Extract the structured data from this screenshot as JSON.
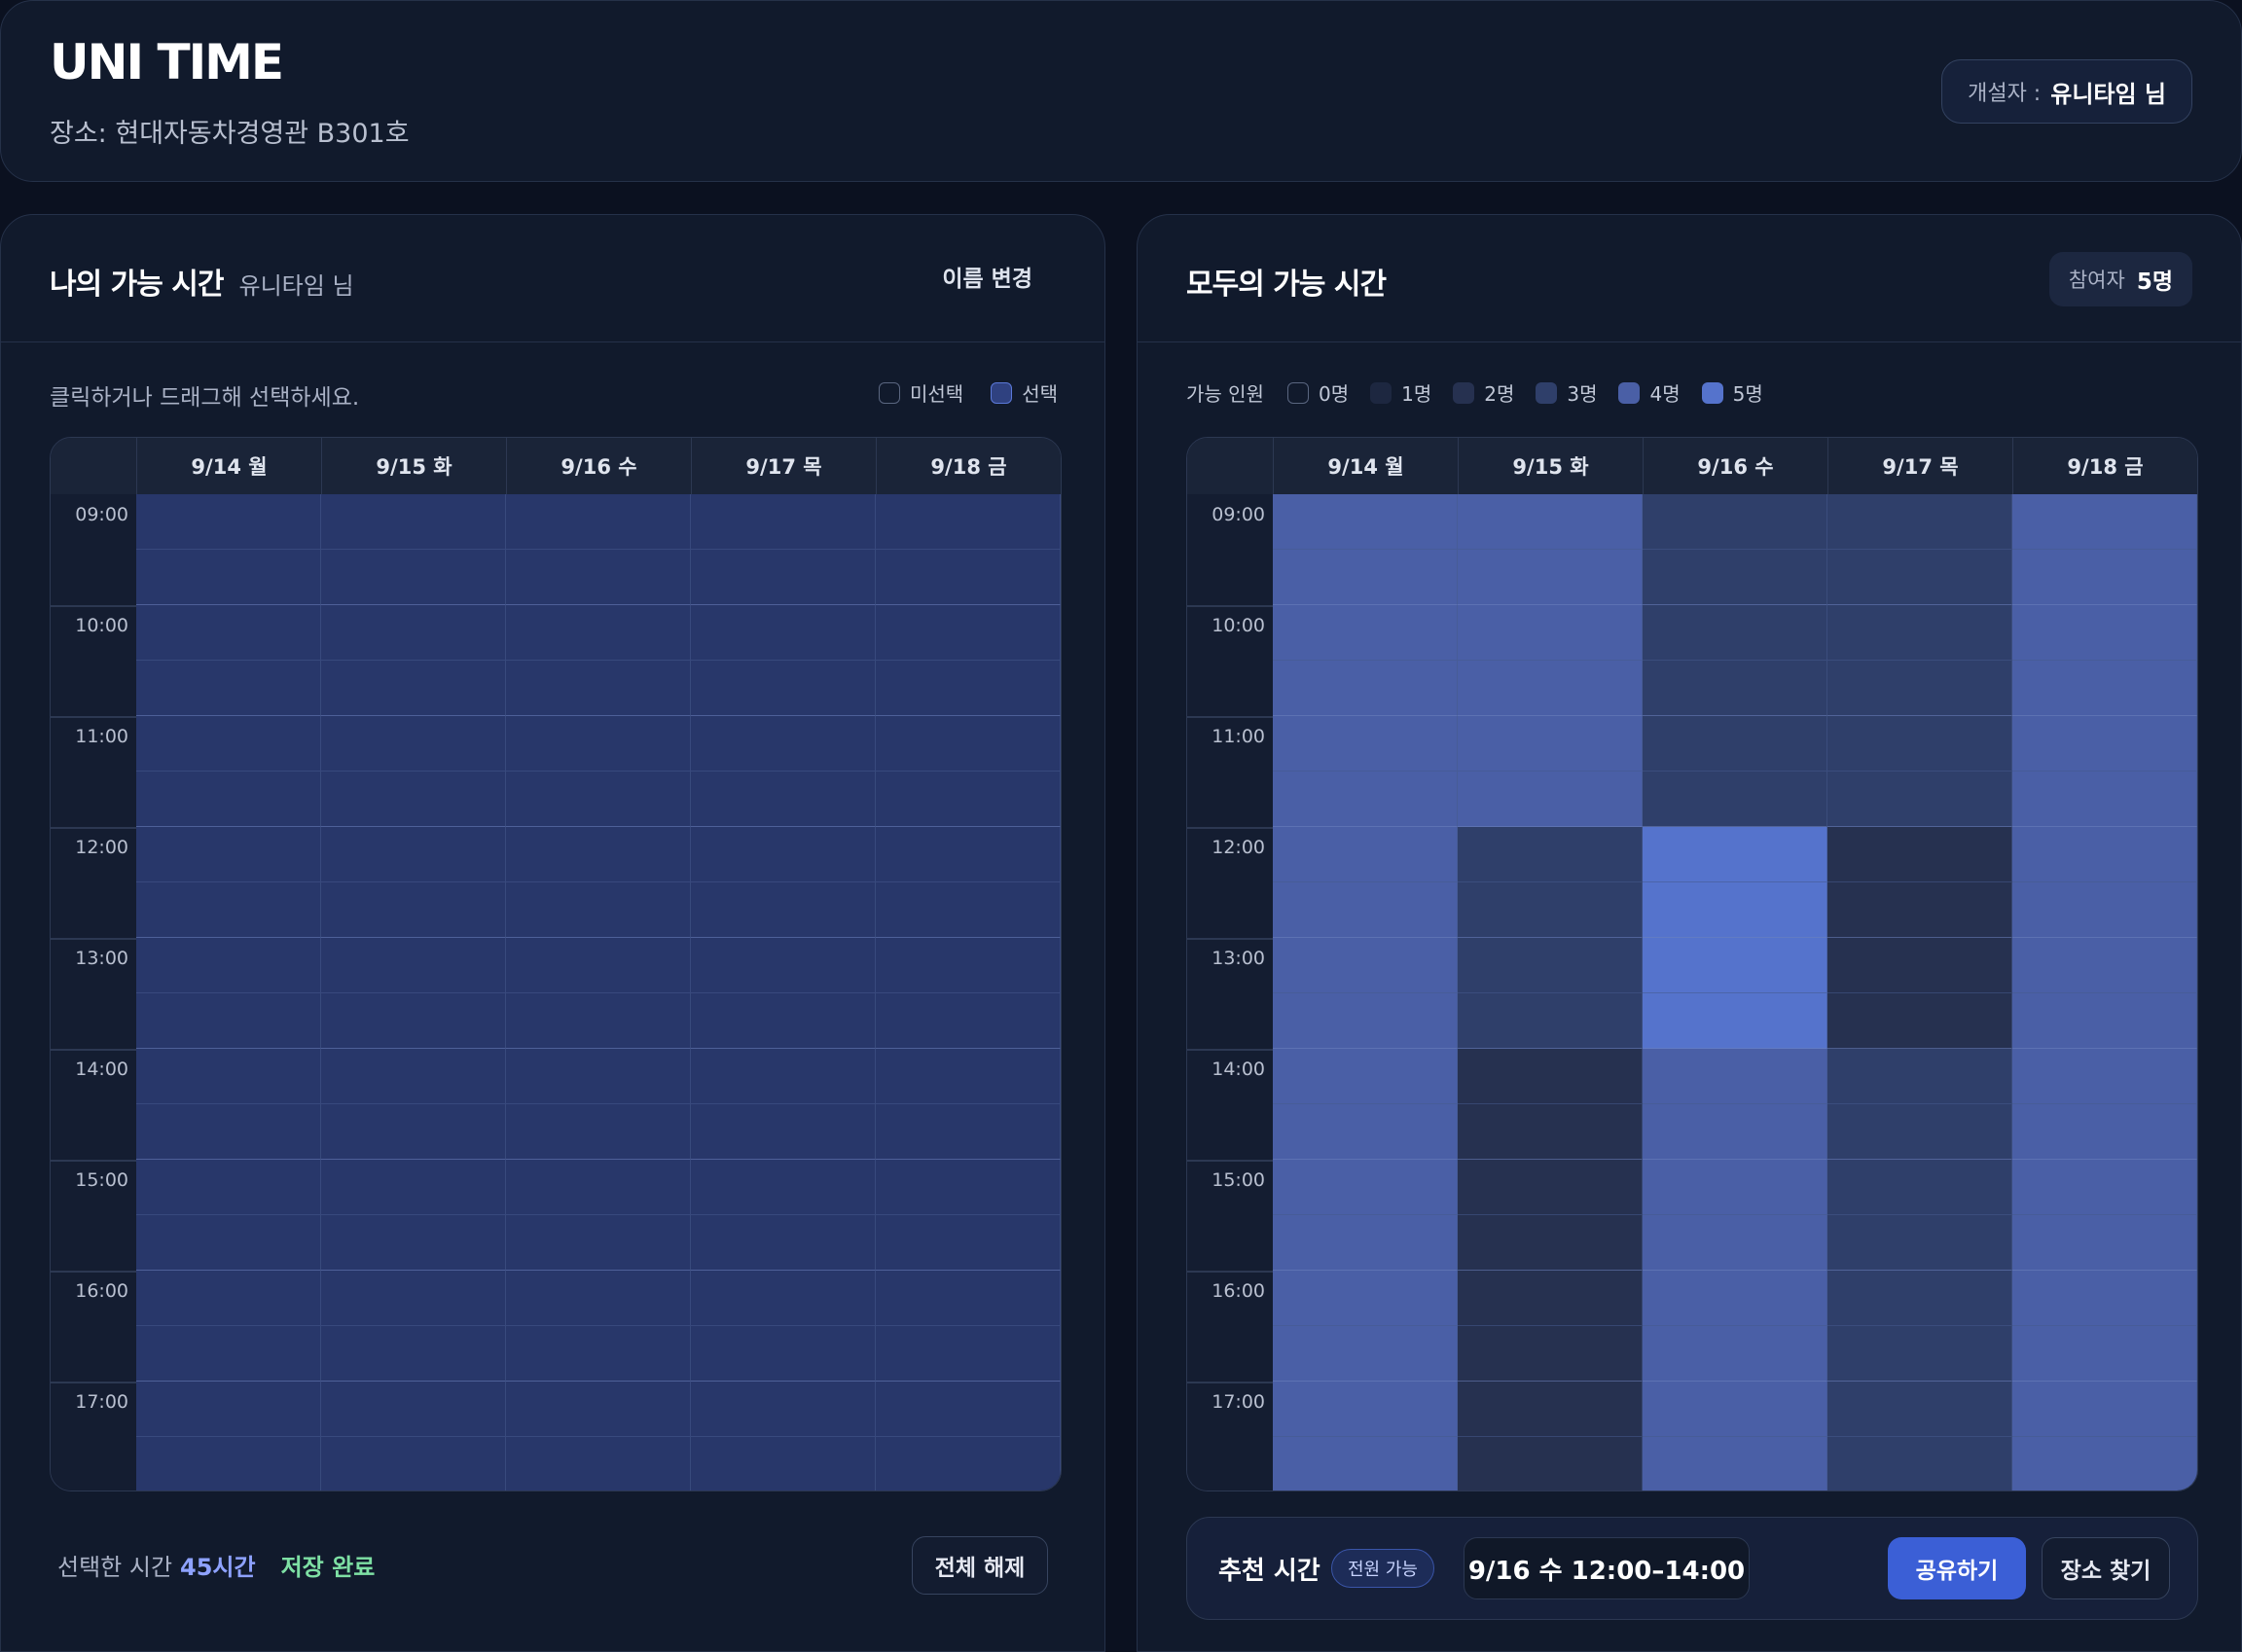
{
  "header": {
    "app_title": "UNI TIME",
    "location": "장소: 현대자동차경영관 B301호",
    "organizer_label": "개설자 :",
    "organizer_name": "유니타임 님"
  },
  "my_panel": {
    "title": "나의 가능 시간",
    "user": "유니타임 님",
    "rename_label": "이름 변경",
    "hint": "클릭하거나 드래그해 선택하세요.",
    "legend": {
      "unselected": "미선택",
      "selected": "선택"
    },
    "summary_prefix": "선택한 시간",
    "summary_hours": "45시간",
    "save_status": "저장 완료",
    "clear_label": "전체 해제"
  },
  "group_panel": {
    "title": "모두의 가능 시간",
    "participants_label": "참여자",
    "participants_count": "5명",
    "legend_label": "가능 인원",
    "legend_items": [
      "0명",
      "1명",
      "2명",
      "3명",
      "4명",
      "5명"
    ],
    "recommend_label": "추천 시간",
    "recommend_badge": "전원 가능",
    "recommend_time": "9/16 수 12:00–14:00",
    "share_label": "공유하기",
    "find_place_label": "장소 찾기"
  },
  "days": [
    "9/14 월",
    "9/15 화",
    "9/16 수",
    "9/17 목",
    "9/18 금"
  ],
  "hours": [
    "09:00",
    "10:00",
    "11:00",
    "12:00",
    "13:00",
    "14:00",
    "15:00",
    "16:00",
    "17:00"
  ],
  "colors": {
    "selected": "#28376a",
    "count_0": "#141d31",
    "count_1": "#1d2740",
    "count_2": "#263150",
    "count_3": "#2f3f6a",
    "count_4": "#4a5fa6",
    "count_5": "#5573cc"
  },
  "my_selected": [
    [
      1,
      1,
      1,
      1,
      1,
      1,
      1,
      1,
      1,
      1,
      1,
      1,
      1,
      1,
      1,
      1,
      1,
      1
    ],
    [
      1,
      1,
      1,
      1,
      1,
      1,
      1,
      1,
      1,
      1,
      1,
      1,
      1,
      1,
      1,
      1,
      1,
      1
    ],
    [
      1,
      1,
      1,
      1,
      1,
      1,
      1,
      1,
      1,
      1,
      1,
      1,
      1,
      1,
      1,
      1,
      1,
      1
    ],
    [
      1,
      1,
      1,
      1,
      1,
      1,
      1,
      1,
      1,
      1,
      1,
      1,
      1,
      1,
      1,
      1,
      1,
      1
    ],
    [
      1,
      1,
      1,
      1,
      1,
      1,
      1,
      1,
      1,
      1,
      1,
      1,
      1,
      1,
      1,
      1,
      1,
      1
    ]
  ],
  "group_counts": [
    [
      4,
      4,
      4,
      4,
      4,
      4,
      4,
      4,
      4,
      4,
      4,
      4,
      4,
      4,
      4,
      4,
      4,
      4
    ],
    [
      4,
      4,
      4,
      4,
      4,
      4,
      3,
      3,
      3,
      3,
      2,
      2,
      2,
      2,
      2,
      2,
      2,
      2
    ],
    [
      3,
      3,
      3,
      3,
      3,
      3,
      5,
      5,
      5,
      5,
      4,
      4,
      4,
      4,
      4,
      4,
      4,
      4
    ],
    [
      3,
      3,
      3,
      3,
      3,
      3,
      2,
      2,
      2,
      2,
      3,
      3,
      3,
      3,
      3,
      3,
      3,
      3
    ],
    [
      4,
      4,
      4,
      4,
      4,
      4,
      4,
      4,
      4,
      4,
      4,
      4,
      4,
      4,
      4,
      4,
      4,
      4
    ]
  ]
}
